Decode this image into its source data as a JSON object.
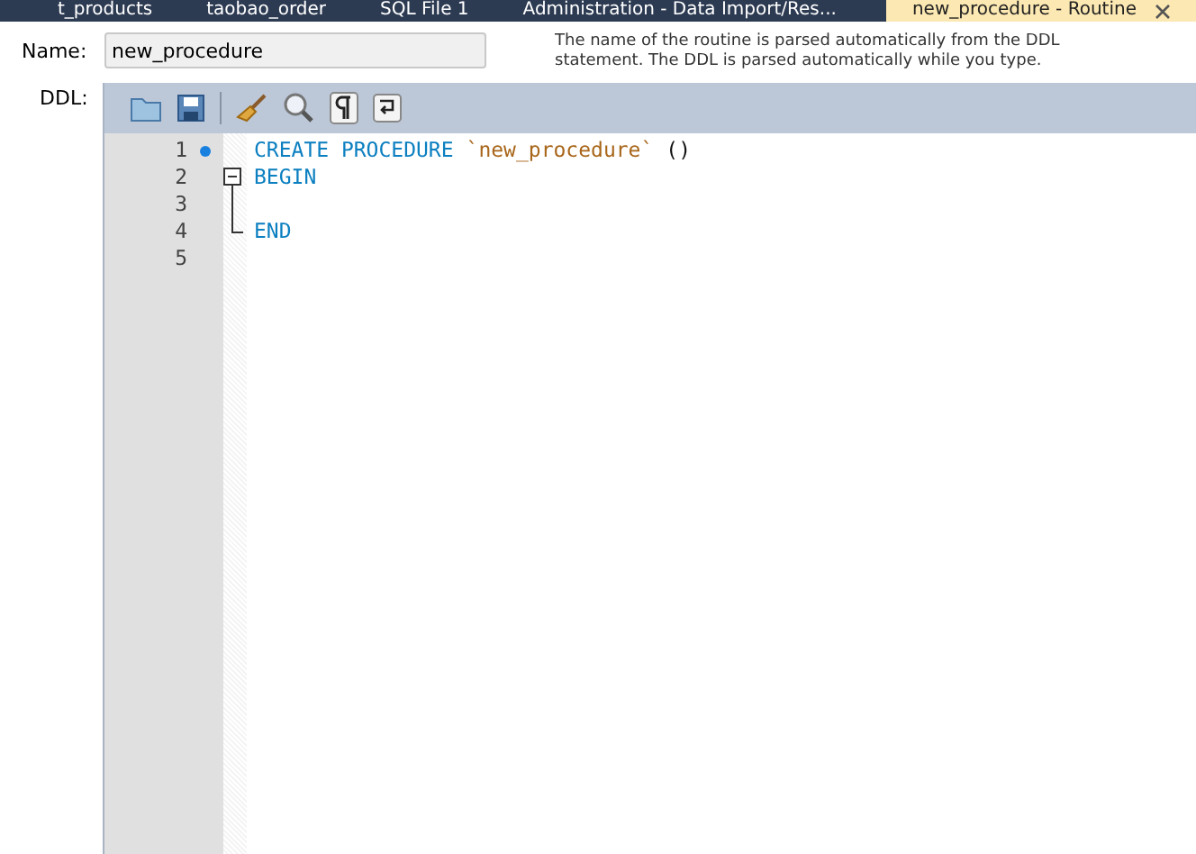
{
  "tabs": [
    {
      "label": "t_products",
      "selected": false,
      "closable": false
    },
    {
      "label": "taobao_order",
      "selected": false,
      "closable": false
    },
    {
      "label": "SQL File 1",
      "selected": false,
      "closable": false
    },
    {
      "label": "Administration - Data Import/Res...",
      "selected": false,
      "closable": false
    },
    {
      "label": "new_procedure - Routine",
      "selected": true,
      "closable": true
    }
  ],
  "name_field": {
    "label": "Name:",
    "value": "new_procedure",
    "hint": "The name of the routine is parsed automatically from the DDL statement. The DDL is parsed automatically while you type."
  },
  "ddl": {
    "label": "DDL:",
    "lines": [
      {
        "number": "1",
        "marker": true,
        "kind": "plain",
        "tokens": [
          {
            "kind": "keyword",
            "text": "CREATE PROCEDURE"
          },
          {
            "kind": "identifier",
            "text": "`new_procedure`"
          },
          {
            "kind": "plain",
            "text": "()"
          }
        ]
      },
      {
        "number": "2",
        "marker": false,
        "kind": "fold-start",
        "tokens": [
          {
            "kind": "keyword",
            "text": "BEGIN"
          }
        ]
      },
      {
        "number": "3",
        "marker": false,
        "kind": "fold-body"
      },
      {
        "number": "4",
        "marker": false,
        "kind": "fold-end",
        "tokens": [
          {
            "kind": "keyword",
            "text": "END"
          }
        ]
      },
      {
        "number": "5",
        "marker": false,
        "kind": "plain"
      }
    ]
  }
}
